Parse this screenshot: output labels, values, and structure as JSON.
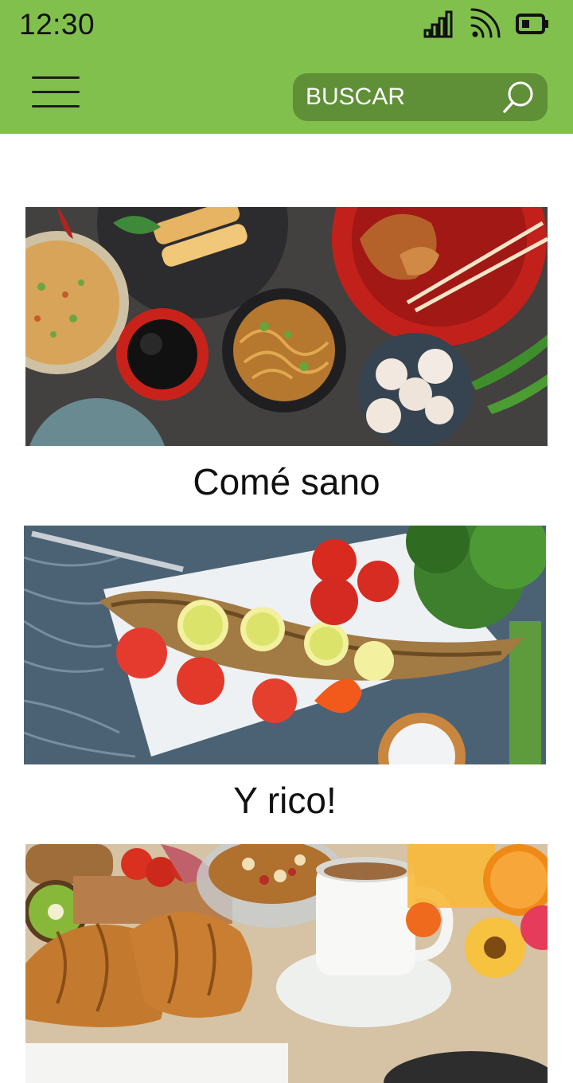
{
  "status_bar": {
    "time": "12:30"
  },
  "header": {
    "search_placeholder": "BUSCAR"
  },
  "cards": [
    {
      "title": "Comé sano",
      "image": "asian-food-spread"
    },
    {
      "title": "Y rico!",
      "image": "grilled-fish-plate"
    },
    {
      "title": "",
      "image": "breakfast-croissants-coffee"
    }
  ],
  "colors": {
    "appbar": "#82c04e",
    "search_bg": "#5f8f37"
  }
}
